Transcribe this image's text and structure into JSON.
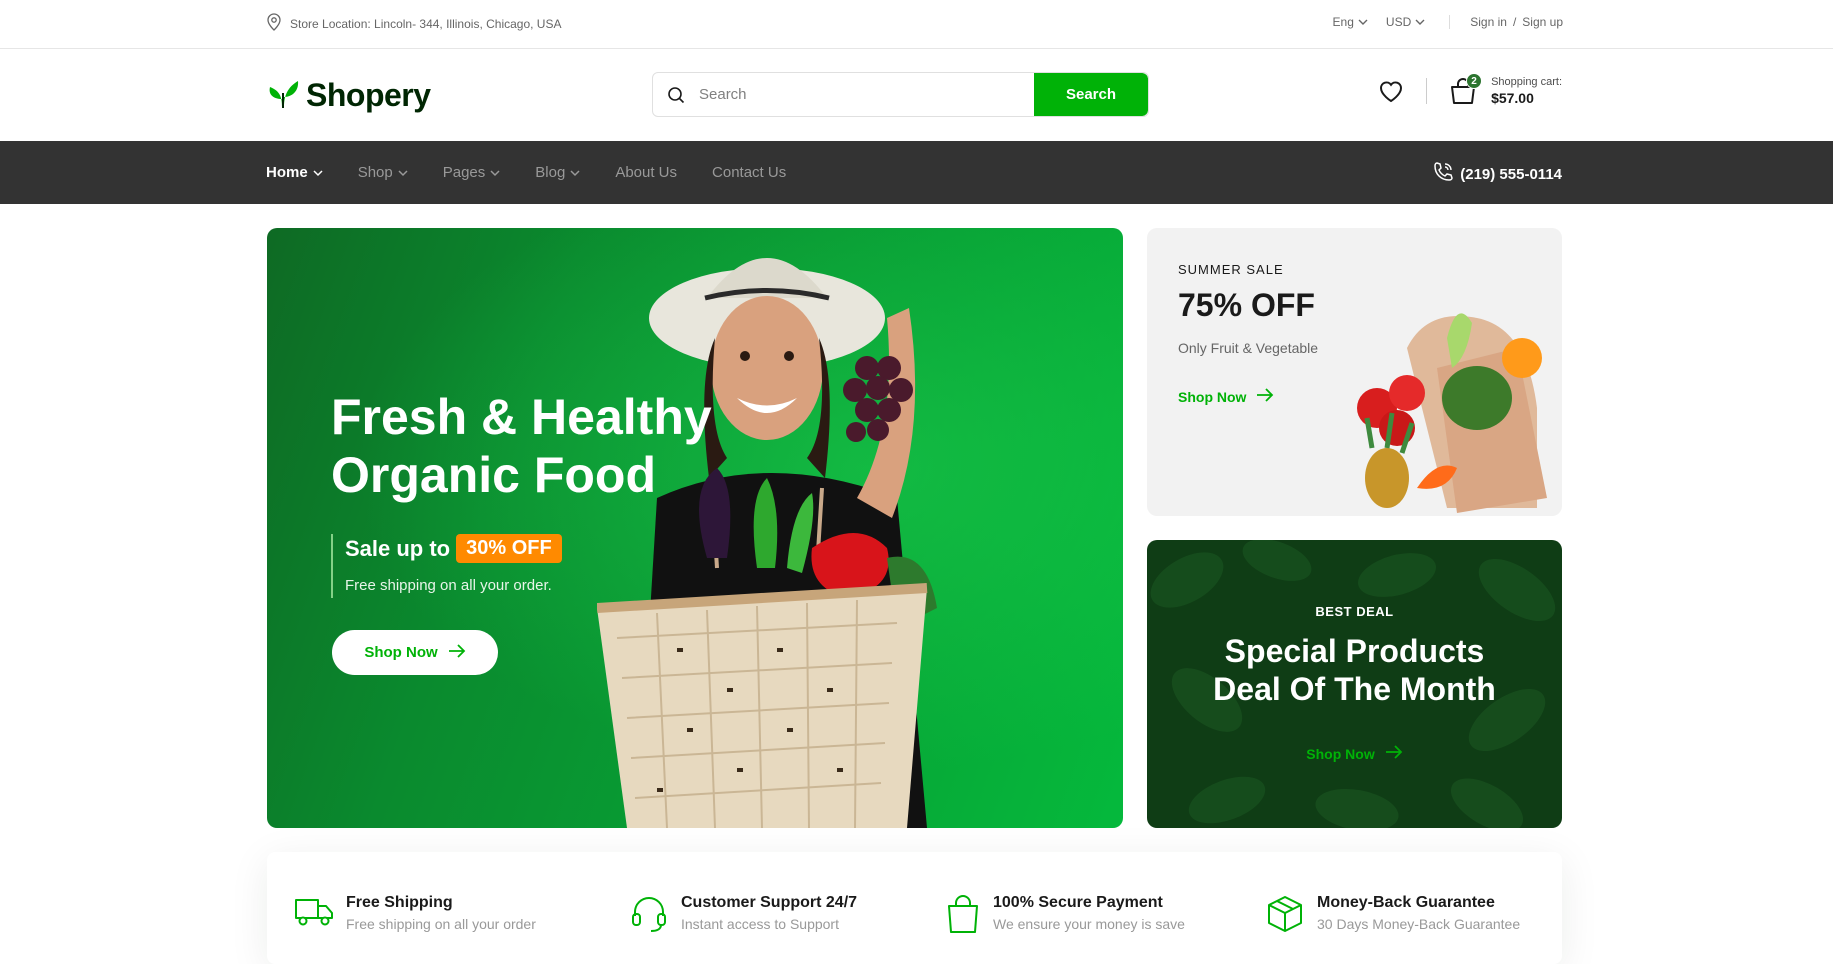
{
  "topbar": {
    "location": "Store Location: Lincoln- 344, Illinois, Chicago, USA",
    "language": "Eng",
    "currency": "USD",
    "sign_in": "Sign in",
    "slash": "/",
    "sign_up": "Sign up"
  },
  "header": {
    "logo": "Shopery",
    "search_placeholder": "Search",
    "search_button": "Search",
    "cart_badge": "2",
    "cart_label": "Shopping cart:",
    "cart_amount": "$57.00"
  },
  "nav": {
    "items": [
      {
        "label": "Home",
        "dropdown": true,
        "active": true
      },
      {
        "label": "Shop",
        "dropdown": true
      },
      {
        "label": "Pages",
        "dropdown": true
      },
      {
        "label": "Blog",
        "dropdown": true
      },
      {
        "label": "About Us",
        "dropdown": false
      },
      {
        "label": "Contact Us",
        "dropdown": false
      }
    ],
    "phone": "(219) 555-0114"
  },
  "hero": {
    "title": "Fresh & Healthy Organic Food",
    "sale_prefix": "Sale up to",
    "sale_badge": "30% OFF",
    "subtitle": "Free shipping on all your order.",
    "button": "Shop Now"
  },
  "promo_summer": {
    "eyebrow": "SUMMER SALE",
    "headline": "75% OFF",
    "subtitle": "Only Fruit & Vegetable",
    "link": "Shop Now"
  },
  "promo_deal": {
    "eyebrow": "BEST DEAL",
    "headline_1": "Special Products",
    "headline_2": "Deal Of The Month",
    "link": "Shop Now"
  },
  "features": [
    {
      "icon": "truck-icon",
      "title": "Free Shipping",
      "desc": "Free shipping on all your order"
    },
    {
      "icon": "headset-icon",
      "title": "Customer Support 24/7",
      "desc": "Instant access to Support"
    },
    {
      "icon": "shopping-bag-icon",
      "title": "100% Secure Payment",
      "desc": "We ensure your money is save"
    },
    {
      "icon": "package-icon",
      "title": "Money-Back Guarantee",
      "desc": "30 Days Money-Back Guarantee"
    }
  ],
  "colors": {
    "brand_green": "#00b207",
    "dark_green": "#2c742f",
    "nav_bg": "#333333",
    "sale_orange": "#ff8a00"
  }
}
